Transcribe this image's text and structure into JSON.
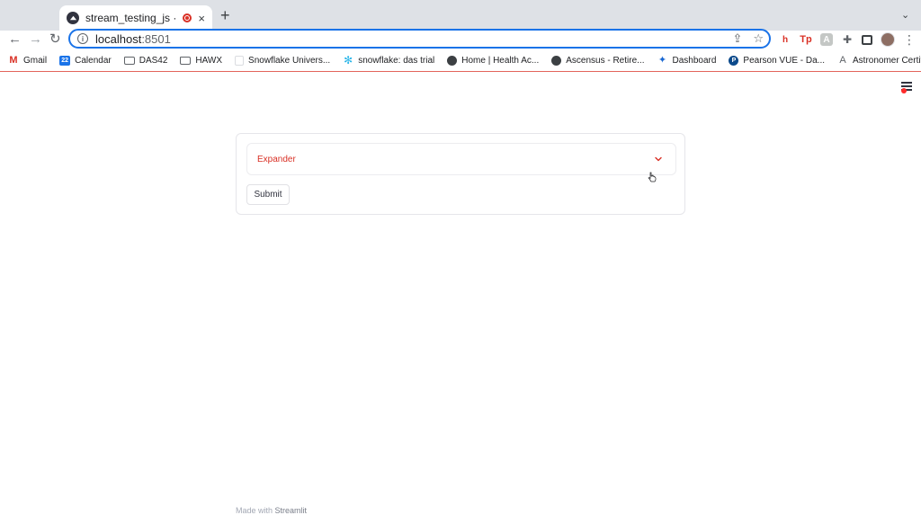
{
  "browser": {
    "tab_title": "stream_testing_js · Streamlit",
    "tab_close": "×",
    "new_tab": "+",
    "tab_search": "⌄",
    "url_host": "localhost",
    "url_port": ":8501",
    "back": "←",
    "forward": "→",
    "reload": "↻",
    "share": "⇪",
    "star": "☆",
    "ext1": "h",
    "ext2": "Tp",
    "ext3": "A",
    "puzzle": "✚",
    "kebab": "⋮",
    "info": "i"
  },
  "bookmarks": [
    {
      "label": "Gmail",
      "icon": "gmail-icon",
      "glyph": "M"
    },
    {
      "label": "Calendar",
      "icon": "calendar-icon",
      "glyph": "22"
    },
    {
      "label": "DAS42",
      "icon": "folder-icon",
      "glyph": ""
    },
    {
      "label": "HAWX",
      "icon": "folder-icon",
      "glyph": ""
    },
    {
      "label": "Snowflake Univers...",
      "icon": "page-icon",
      "glyph": ""
    },
    {
      "label": "snowflake: das trial",
      "icon": "snowflake-icon",
      "glyph": "✻"
    },
    {
      "label": "Home | Health Ac...",
      "icon": "globe-icon",
      "glyph": ""
    },
    {
      "label": "Ascensus - Retire...",
      "icon": "globe-icon",
      "glyph": ""
    },
    {
      "label": "Dashboard",
      "icon": "dashboard-icon",
      "glyph": "✦"
    },
    {
      "label": "Pearson VUE - Da...",
      "icon": "pearson-icon",
      "glyph": "P"
    },
    {
      "label": "Astronomer Certif...",
      "icon": "astronomer-icon",
      "glyph": "A"
    }
  ],
  "app": {
    "expander_label": "Expander",
    "submit_label": "Submit",
    "footer_prefix": "Made with ",
    "footer_brand": "Streamlit"
  },
  "colors": {
    "accent": "#d93025",
    "omnibox_focus": "#1a73e8"
  }
}
